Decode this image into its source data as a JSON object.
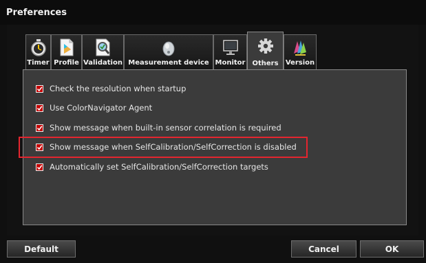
{
  "window": {
    "title": "Preferences"
  },
  "tabs": [
    {
      "label": "Timer",
      "icon": "stopwatch-icon"
    },
    {
      "label": "Profile",
      "icon": "profile-icon"
    },
    {
      "label": "Validation",
      "icon": "validation-magnifier-icon"
    },
    {
      "label": "Measurement device",
      "icon": "sensor-mouse-icon"
    },
    {
      "label": "Monitor",
      "icon": "monitor-icon"
    },
    {
      "label": "Others",
      "icon": "gear-icon",
      "active": true
    },
    {
      "label": "Version",
      "icon": "version-icon"
    }
  ],
  "options": [
    {
      "label": "Check the resolution when startup",
      "checked": true
    },
    {
      "label": "Use ColorNavigator Agent",
      "checked": true
    },
    {
      "label": "Show message when built-in sensor correlation is required",
      "checked": true
    },
    {
      "label": "Show message when SelfCalibration/SelfCorrection is disabled",
      "checked": true,
      "highlighted": true
    },
    {
      "label": "Automatically set SelfCalibration/SelfCorrection targets",
      "checked": true
    }
  ],
  "buttons": {
    "default": "Default",
    "cancel": "Cancel",
    "ok": "OK"
  },
  "colors": {
    "checkbox": "#c50000",
    "highlight": "#e5252f",
    "background": "#101010",
    "panel": "#3b3b3b"
  }
}
